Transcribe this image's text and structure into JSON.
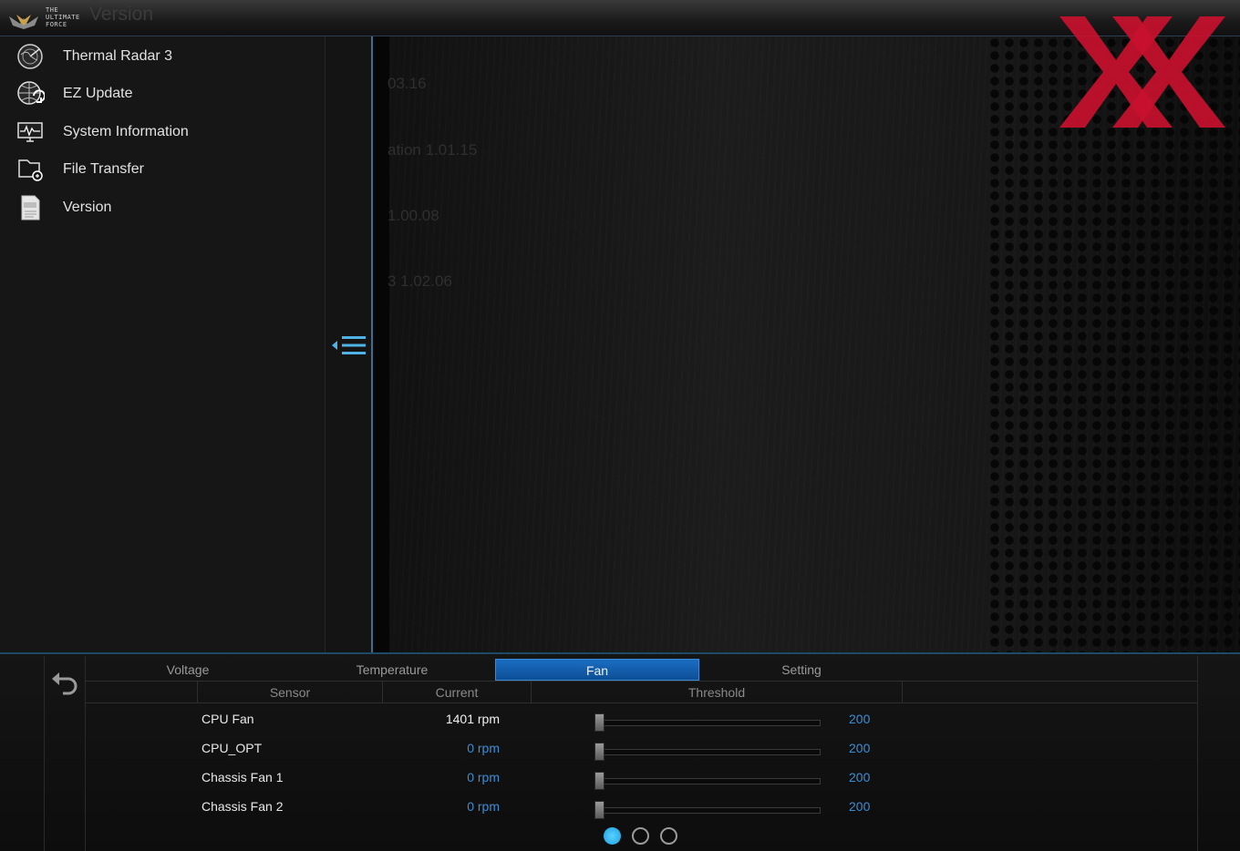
{
  "app": {
    "brand_lines": [
      "THE",
      "ULTIMATE",
      "FORCE"
    ],
    "title": "Version"
  },
  "sidebar": {
    "items": [
      {
        "label": "Thermal Radar 3",
        "icon": "radar-icon"
      },
      {
        "label": "EZ Update",
        "icon": "globe-update-icon"
      },
      {
        "label": "System Information",
        "icon": "monitor-icon"
      },
      {
        "label": "File Transfer",
        "icon": "file-transfer-icon"
      },
      {
        "label": "Version",
        "icon": "version-document-icon"
      }
    ]
  },
  "main": {
    "ghost_lines": [
      "03.16",
      "ation   1.01.15",
      "1.00.08",
      "3   1.02.06"
    ]
  },
  "monitor": {
    "tabs": [
      "Voltage",
      "Temperature",
      "Fan",
      "Setting"
    ],
    "active_tab": "Fan",
    "columns": [
      "Sensor",
      "Current",
      "Threshold"
    ],
    "rows": [
      {
        "sensor": "CPU Fan",
        "current": "1401 rpm",
        "threshold": "200",
        "active": true
      },
      {
        "sensor": "CPU_OPT",
        "current": "0 rpm",
        "threshold": "200",
        "active": false
      },
      {
        "sensor": "Chassis Fan 1",
        "current": "0 rpm",
        "threshold": "200",
        "active": false
      },
      {
        "sensor": "Chassis Fan 2",
        "current": "0 rpm",
        "threshold": "200",
        "active": false
      }
    ],
    "pages": 3,
    "current_page": 1
  },
  "colors": {
    "accent": "#1a6dc2",
    "value_blue": "#3e8dd3",
    "logo_red": "#c8102e"
  }
}
